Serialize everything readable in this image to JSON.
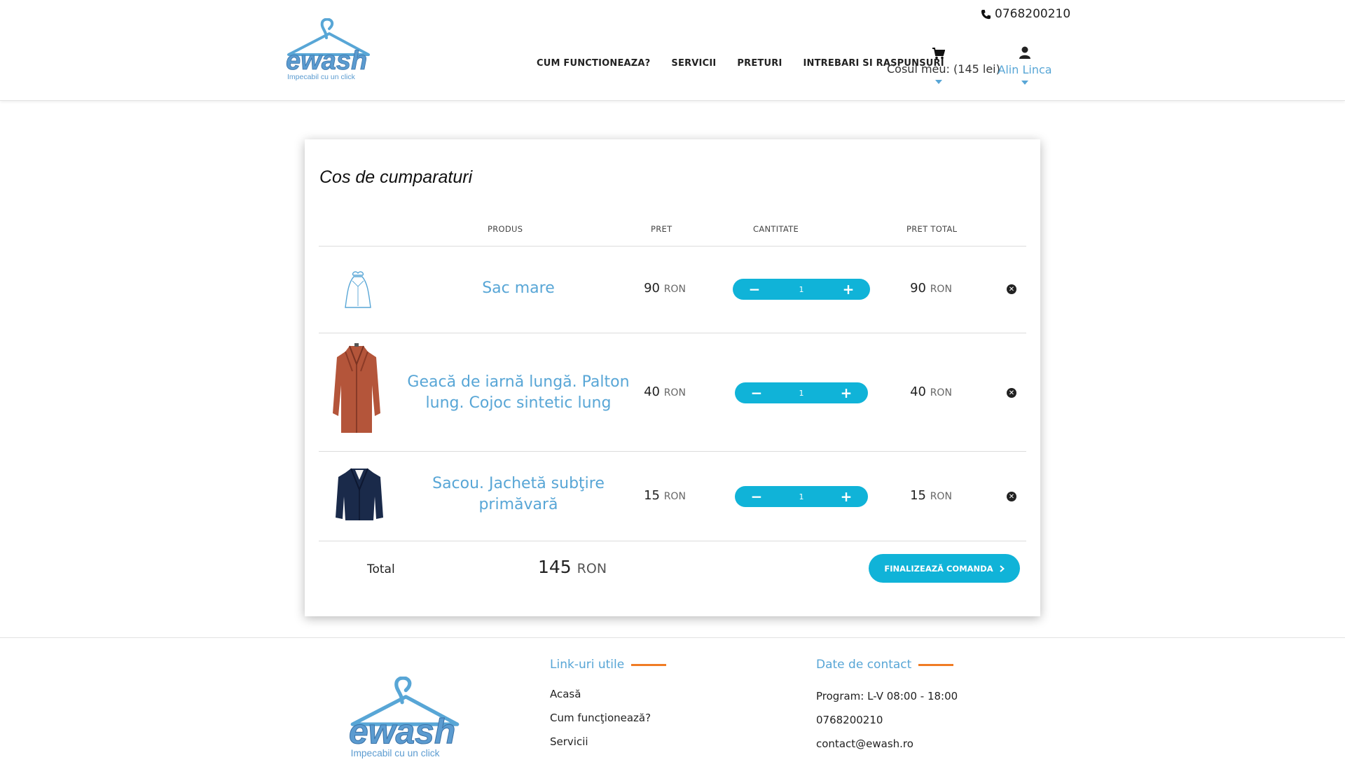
{
  "brand": {
    "logo_text": "ewash",
    "tagline": "Impecabil cu un click",
    "color": "#58a6d6"
  },
  "header": {
    "phone": "0768200210",
    "nav": [
      {
        "label": "CUM FUNCTIONEAZA?"
      },
      {
        "label": "SERVICII"
      },
      {
        "label": "PRETURI"
      },
      {
        "label": "INTREBARI SI RASPUNSURI"
      }
    ],
    "cart_label": "Cosul meu: (145 lei)",
    "user_name": "Alin Linca"
  },
  "cart": {
    "title": "Cos de cumparaturi",
    "columns": {
      "product": "PRODUS",
      "price": "PRET",
      "quantity": "CANTITATE",
      "total_price": "PRET TOTAL"
    },
    "currency": "RON",
    "items": [
      {
        "name": "Sac mare",
        "price": "90",
        "qty": "1",
        "total": "90",
        "icon": "bag-icon"
      },
      {
        "name": "Geacă de iarnă lungă. Palton lung. Cojoc sintetic lung",
        "price": "40",
        "qty": "1",
        "total": "40",
        "icon": "coat-image"
      },
      {
        "name": "Sacou. Jachetă subţire primăvară",
        "price": "15",
        "qty": "1",
        "total": "15",
        "icon": "jacket-image"
      }
    ],
    "total_label": "Total",
    "total_value": "145",
    "checkout_label": "FINALIZEAZĂ COMANDA",
    "accent": "#10b3d8"
  },
  "footer": {
    "links_title": "Link-uri utile",
    "links": [
      "Acasă",
      "Cum funcţionează?",
      "Servicii"
    ],
    "contact_title": "Date de contact",
    "schedule": "Program: L-V 08:00 - 18:00",
    "phone": "0768200210",
    "email": "contact@ewash.ro",
    "accent": "#f07c24"
  }
}
